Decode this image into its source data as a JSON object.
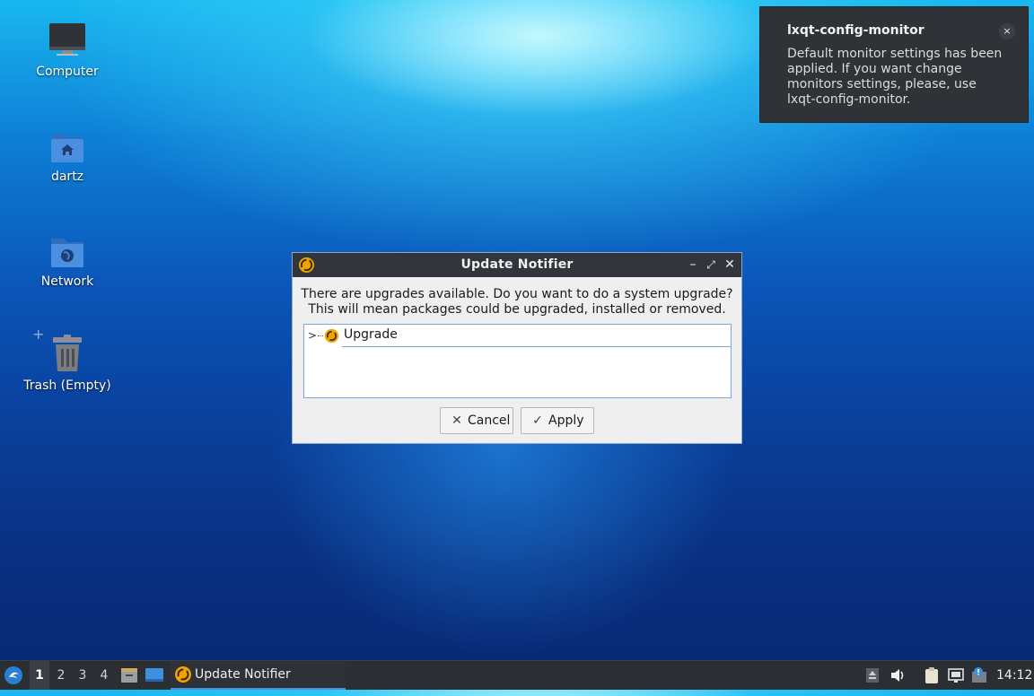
{
  "desktop": {
    "icons": [
      {
        "label": "Computer",
        "icon": "computer-icon"
      },
      {
        "label": "dartz",
        "icon": "home-folder-icon"
      },
      {
        "label": "Network",
        "icon": "network-folder-icon"
      },
      {
        "label": "Trash (Empty)",
        "icon": "trash-icon"
      }
    ]
  },
  "notification": {
    "title": "lxqt-config-monitor",
    "body": "Default monitor settings has been applied. If you want change monitors settings, please, use lxqt-config-monitor.",
    "close_glyph": "×"
  },
  "dialog": {
    "title": "Update Notifier",
    "message_line1": "There are upgrades available. Do you want to do a system upgrade?",
    "message_line2": "This will mean packages could be upgraded, installed or removed.",
    "tree_items": [
      {
        "label": "Upgrade",
        "expanded": false
      }
    ],
    "cancel_label": "Cancel",
    "apply_label": "Apply",
    "minimize_glyph": "–",
    "maximize_glyph": "⤢",
    "close_glyph": "✕"
  },
  "taskbar": {
    "workspaces": [
      "1",
      "2",
      "3",
      "4"
    ],
    "active_workspace": "1",
    "task_label": "Update Notifier",
    "clock": "14:12"
  },
  "colors": {
    "accent": "#4f8fd8",
    "titlebar": "#32363c",
    "taskbar": "#2b2f34",
    "update_icon": "#f0a400"
  }
}
